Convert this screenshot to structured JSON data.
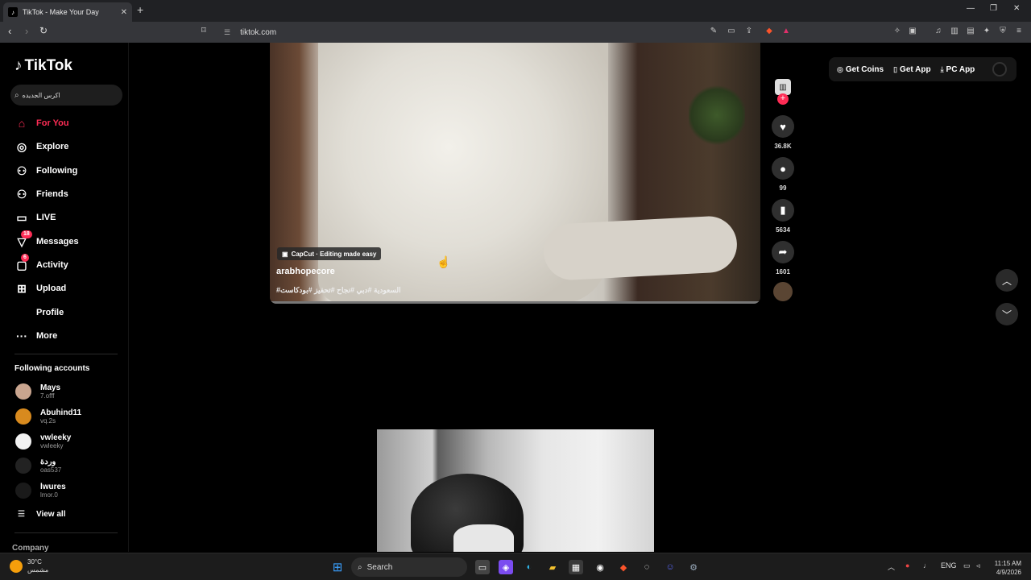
{
  "browser": {
    "tab_title": "TikTok - Make Your Day",
    "tab_close": "✕",
    "new_tab": "+",
    "url": "tiktok.com",
    "window_controls": [
      "—",
      "❐",
      "✕"
    ]
  },
  "sidebar": {
    "logo": "TikTok",
    "search_text": "اكرس الجديده",
    "nav": [
      {
        "label": "For You",
        "icon": "⌂",
        "active": true
      },
      {
        "label": "Explore",
        "icon": "◎"
      },
      {
        "label": "Following",
        "icon": "⚇"
      },
      {
        "label": "Friends",
        "icon": "⚇"
      },
      {
        "label": "LIVE",
        "icon": "▭"
      },
      {
        "label": "Messages",
        "icon": "▽",
        "badge": "18"
      },
      {
        "label": "Activity",
        "icon": "▢",
        "badge": "6"
      },
      {
        "label": "Upload",
        "icon": "⊞"
      },
      {
        "label": "Profile",
        "icon": ""
      },
      {
        "label": "More",
        "icon": "···"
      }
    ],
    "following_title": "Following accounts",
    "accounts": [
      {
        "name": "Mays",
        "handle": "7.offf"
      },
      {
        "name": "Abuhind11",
        "handle": "vq.2s"
      },
      {
        "name": "vwleeky",
        "handle": "vwleeky"
      },
      {
        "name": "وردة",
        "handle": "oas537"
      },
      {
        "name": "lwures",
        "handle": "lmor.0"
      }
    ],
    "view_all": "View all",
    "company": "Company"
  },
  "video": {
    "capcut": "CapCut · Editing made easy",
    "username": "arabhopecore",
    "tags": "#السعودية #دبي #نجاح #تحفيز #بودكاست",
    "likes": "36.8K",
    "comments": "99",
    "saves": "5634",
    "shares": "1601"
  },
  "topbar": {
    "get_coins": "Get Coins",
    "get_app": "Get App",
    "pc_app": "PC App"
  },
  "taskbar": {
    "temp": "30°C",
    "weather": "مشمس",
    "search": "Search",
    "lang": "ENG",
    "time": "11:15 AM",
    "date": "4/9/2026"
  }
}
